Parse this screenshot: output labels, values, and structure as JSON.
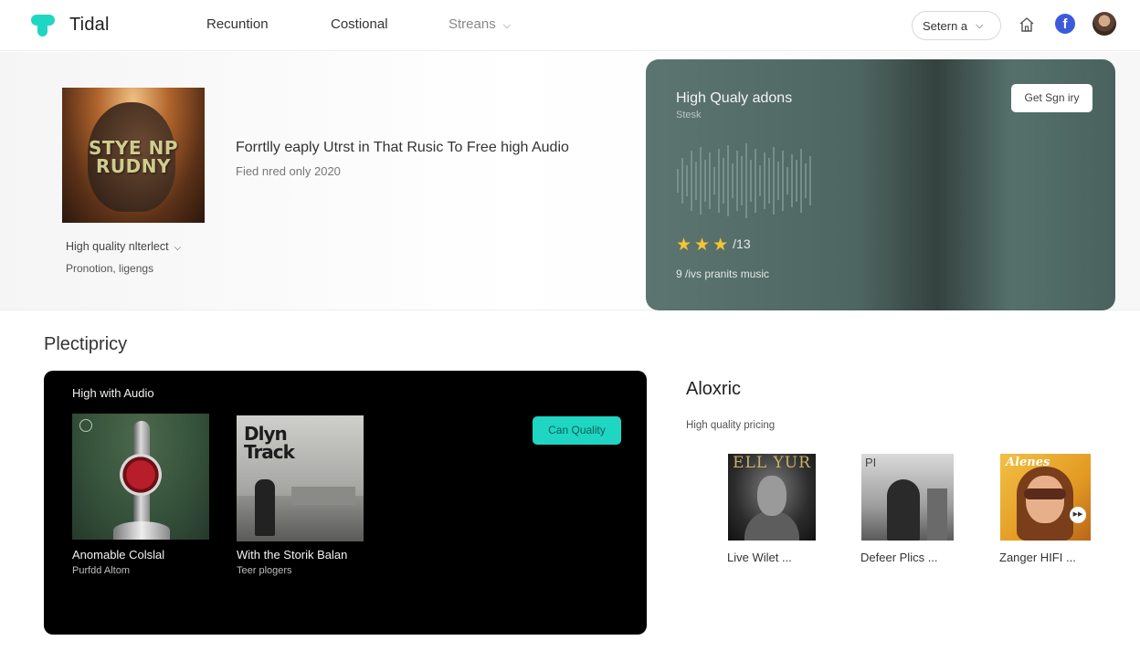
{
  "app": {
    "name": "Tidal",
    "accent_color": "#1fd6c3"
  },
  "nav": {
    "links": [
      "Recuntion",
      "Costional",
      "Streans"
    ],
    "select_label": "Setern a",
    "icons": [
      "home-icon",
      "facebook-icon",
      "avatar"
    ]
  },
  "hero": {
    "album_art_text": "STYE NP RUDNY",
    "title": "Forrtlly eaply Utrst in That Rusic To Free high Audio",
    "subtitle": "Fied nred only 2020",
    "dropdown_label": "High quality nlterlect",
    "meta": "Pronotion, ligengs"
  },
  "promo": {
    "title": "High Qualy adons",
    "subtitle": "Stesk",
    "button_label": "Get Sgn iry",
    "rating_stars": 3,
    "rating_label": "/13",
    "note": "9 /ivs pranits music"
  },
  "section": {
    "title": "Plectipricy",
    "panel": {
      "label": "High with Audio",
      "button_label": "Can Quality",
      "cards": [
        {
          "title": "Anomable Colslal",
          "subtitle": "Purfdd Altom"
        },
        {
          "title": "With the Storik Balan",
          "subtitle": "Teer plogers",
          "art_text": "Dlyn Track"
        }
      ]
    },
    "right": {
      "title": "Aloxric",
      "subtitle": "High quality pricing",
      "cards": [
        {
          "title": "Live Wilet ...",
          "art_text": "ELL YUR"
        },
        {
          "title": "Defeer Plics ...",
          "art_text": "PI"
        },
        {
          "title": "Zanger HIFI ...",
          "art_text": "Alenes"
        }
      ]
    }
  }
}
